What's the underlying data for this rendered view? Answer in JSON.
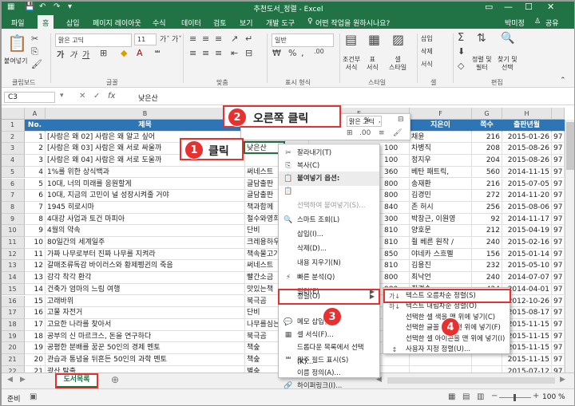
{
  "titlebar": {
    "title": "추천도서_정렬 - Excel"
  },
  "tabs": [
    "파일",
    "홈",
    "삽입",
    "페이지 레이아웃",
    "수식",
    "데이터",
    "검토",
    "보기",
    "개발 도구"
  ],
  "tell_me": "어떤 작업을 원하시나요?",
  "user": "박미정",
  "share": "공유",
  "ribbon": {
    "paste": "붙여넣기",
    "font_name": "맑은 고딕",
    "font_size": "11",
    "bold": "가",
    "italic": "가",
    "underline": "가",
    "number_format": "일반",
    "percent": "%",
    "comma": ",",
    "cond_format": [
      "조건부",
      "서식"
    ],
    "table_format": [
      "표",
      "서식"
    ],
    "cell_style": [
      "셀",
      "스타일"
    ],
    "insert": "삽입",
    "delete": "삭제",
    "format": "서식",
    "sort_filter": [
      "정렬 및",
      "필터"
    ],
    "find_select": [
      "찾기 및",
      "선택"
    ],
    "groups": [
      "클립보드",
      "글꼴",
      "맞춤",
      "표시 형식",
      "스타일",
      "셀",
      "편집"
    ]
  },
  "formula": {
    "namebox": "C3",
    "fx": "fx",
    "value": "낮은산"
  },
  "columns": [
    "A",
    "B",
    "C",
    "D",
    "E",
    "F",
    "G",
    "H"
  ],
  "rows": [
    {
      "n": "1",
      "a": "No.",
      "b": "제목",
      "c": "",
      "f": "지은이",
      "g": "쪽수",
      "h": "출판년월",
      "i": ""
    },
    {
      "n": "2",
      "a": "1",
      "b": "[사람은 왜 02] 사람은 왜 알고 싶어",
      "c": "낮은산",
      "f": "채윤",
      "g": "216",
      "h": "2015-01-26",
      "i": "97"
    },
    {
      "n": "3",
      "a": "2",
      "b": "[사람은 왜 03] 사람은 왜 서로 싸울까",
      "c": "낮은산",
      "f": "차병직",
      "g": "208",
      "h": "2015-08-26",
      "i": "97"
    },
    {
      "n": "4",
      "a": "3",
      "b": "[사람은 왜 04] 사람은 왜 서로 도울까",
      "c": "",
      "f": "정지우",
      "g": "204",
      "h": "2015-08-26",
      "i": "97"
    },
    {
      "n": "5",
      "a": "4",
      "b": "1%를 위한 상식백과",
      "c": "써네스트",
      "f": "베탄 패트릭,",
      "g": "560",
      "h": "2014-11-15",
      "i": "97"
    },
    {
      "n": "6",
      "a": "5",
      "b": "10대, 너의 미래를 응원할게",
      "c": "글담출판",
      "f": "송재환",
      "g": "216",
      "h": "2015-07-05",
      "i": "97"
    },
    {
      "n": "7",
      "a": "6",
      "b": "10대, 지금의 고민이 널 성장시켜줄 거야",
      "c": "글담출판",
      "f": "김경민",
      "g": "272",
      "h": "2014-11-20",
      "i": "97"
    },
    {
      "n": "8",
      "a": "7",
      "b": "1945 히로시마",
      "c": "책과함께",
      "f": "존 허시",
      "g": "256",
      "h": "2015-08-06",
      "i": "97"
    },
    {
      "n": "9",
      "a": "8",
      "b": "4대강 사업과 토건 마피아",
      "c": "철수와영희",
      "f": "박창근, 이원영",
      "g": "92",
      "h": "2014-11-17",
      "i": "97"
    },
    {
      "n": "10",
      "a": "9",
      "b": "4월의 약속",
      "c": "단비",
      "f": "양호문",
      "g": "212",
      "h": "2015-04-19",
      "i": "97"
    },
    {
      "n": "11",
      "a": "10",
      "b": "80일간의 세계일주",
      "c": "크레용하우스",
      "f": "쥘 베른 원작 /",
      "g": "240",
      "h": "2015-02-16",
      "i": "97"
    },
    {
      "n": "12",
      "a": "11",
      "b": "가짜 나무로부터 진짜 나무를 지켜라",
      "c": "책속물고기",
      "f": "야네카 스흐펠",
      "g": "156",
      "h": "2015-01-14",
      "i": "97"
    },
    {
      "n": "13",
      "a": "12",
      "b": "갈매조류독감 바이러스와 황제펭귄의 죽음",
      "c": "써네스트",
      "f": "김용진",
      "g": "232",
      "h": "2015-05-10",
      "i": "97"
    },
    {
      "n": "14",
      "a": "13",
      "b": "감각 착각 환각",
      "c": "빨간소금",
      "f": "최낙언",
      "g": "240",
      "h": "2014-07-07",
      "i": "97"
    },
    {
      "n": "15",
      "a": "14",
      "b": "건축가 엄마의 느림 여행",
      "c": "맛있는책",
      "f": "최경숙",
      "g": "424",
      "h": "2014-04-01",
      "i": "97"
    },
    {
      "n": "16",
      "a": "15",
      "b": "고래바위",
      "c": "북극곰",
      "f": "",
      "g": "",
      "h": "2012-10-26",
      "i": "97"
    },
    {
      "n": "17",
      "a": "16",
      "b": "고물 자전거",
      "c": "단비",
      "f": "",
      "g": "",
      "h": "2015-08-17",
      "i": "97"
    },
    {
      "n": "18",
      "a": "17",
      "b": "고요한 나라를 찾아서",
      "c": "나무를심는",
      "f": "",
      "g": "",
      "h": "2015-11-15",
      "i": "97"
    },
    {
      "n": "19",
      "a": "18",
      "b": "공부의 신 마르크스, 돈을 연구하다",
      "c": "북극곰",
      "f": "",
      "g": "",
      "h": "2015-11-15",
      "i": "97"
    },
    {
      "n": "20",
      "a": "19",
      "b": "공평한 분배를 꿈꾼 50인의 경제 멘토",
      "c": "책숲",
      "f": "",
      "g": "",
      "h": "2015-11-15",
      "i": "97"
    },
    {
      "n": "21",
      "a": "20",
      "b": "관습과 통념을 뒤흔든 50인의 과학 멘토",
      "c": "책숲",
      "f": "",
      "g": "",
      "h": "2015-11-15",
      "i": "97"
    },
    {
      "n": "22",
      "a": "21",
      "b": "광산 탈출",
      "c": "별숲",
      "f": "",
      "g": "",
      "h": "2015-07-12",
      "i": "97"
    },
    {
      "n": "23",
      "a": "22",
      "b": "괜찮아, 방황이야!",
      "c": "와이스쿨",
      "f": "김혜정",
      "g": "",
      "h": "",
      "i": "97"
    }
  ],
  "e_col": [
    "",
    "100",
    "100",
    "100",
    "360",
    "800",
    "800",
    "840",
    "300",
    "810",
    "810",
    "850",
    "810",
    "800",
    "980",
    "",
    "",
    "",
    "",
    "",
    "",
    "",
    ""
  ],
  "mini_toolbar": {
    "font": "맑은 고딕",
    "size": "11",
    "percent": "%",
    "comma": ","
  },
  "context_menu": [
    {
      "icon": "✂",
      "label": "잘라내기(T)",
      "state": "normal"
    },
    {
      "icon": "⎘",
      "label": "복사(C)",
      "state": "normal"
    },
    {
      "icon": "📋",
      "label": "붙여넣기 옵션:",
      "state": "header"
    },
    {
      "icon": "📋",
      "label": "",
      "state": "normal"
    },
    {
      "icon": "",
      "label": "선택하여 붙여넣기(S)...",
      "state": "disabled"
    },
    {
      "icon": "🔍",
      "label": "스마트 조회(L)",
      "state": "normal"
    },
    {
      "icon": "",
      "label": "삽입(I)...",
      "state": "normal"
    },
    {
      "icon": "",
      "label": "삭제(D)...",
      "state": "normal"
    },
    {
      "icon": "",
      "label": "내용 지우기(N)",
      "state": "normal"
    },
    {
      "icon": "⚡",
      "label": "빠른 분석(Q)",
      "state": "normal"
    },
    {
      "icon": "",
      "label": "필터(E)",
      "state": "arrow"
    },
    {
      "icon": "",
      "label": "정렬(O)",
      "state": "selected"
    },
    {
      "icon": "💬",
      "label": "메모 삽입(M)",
      "state": "normal"
    },
    {
      "icon": "▦",
      "label": "셀 서식(F)...",
      "state": "normal"
    },
    {
      "icon": "",
      "label": "드롭다운 목록에서 선택(K)...",
      "state": "normal"
    },
    {
      "icon": "ᄈ",
      "label": "윗주 필드 표시(S)",
      "state": "normal"
    },
    {
      "icon": "",
      "label": "이름 정의(A)...",
      "state": "normal"
    },
    {
      "icon": "🔗",
      "label": "하이퍼링크(I)...",
      "state": "normal"
    }
  ],
  "sort_submenu": [
    {
      "icon": "가↓",
      "label": "텍스트 오름차순 정렬(S)"
    },
    {
      "icon": "하↓",
      "label": "텍스트 내림차순 정렬(O)"
    },
    {
      "icon": "",
      "label": "선택한 셀 색을 맨 위에 넣기(C)"
    },
    {
      "icon": "",
      "label": "선택한 글꼴 색을 맨 위에 넣기(F)"
    },
    {
      "icon": "",
      "label": "선택한 셀 아이콘을 맨 위에 넣기(I)"
    },
    {
      "icon": "↕",
      "label": "사용자 지정 정렬(U)..."
    }
  ],
  "callouts": {
    "c1": {
      "num": "1",
      "text": "클릭"
    },
    "c2": {
      "num": "2",
      "text": "오른쪽 클릭"
    },
    "c3": {
      "num": "3"
    },
    "c4": {
      "num": "4"
    }
  },
  "sheet_tab": "도서목록",
  "status": {
    "ready": "준비",
    "zoom": "100 %"
  },
  "colors": {
    "excel_green": "#217346",
    "header_blue": "#2e75b6",
    "callout_red": "#e8312f"
  }
}
